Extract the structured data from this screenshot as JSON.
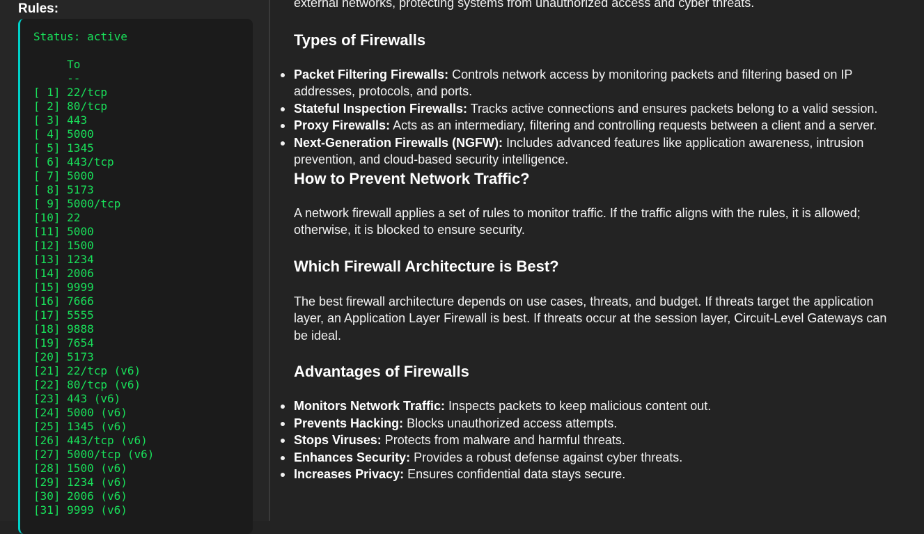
{
  "sidebar": {
    "heading": "Rules:",
    "status": "Status: active",
    "column_header": "     To",
    "column_rule": "     --",
    "rules": [
      {
        "id": "[ 1]",
        "to": "22/tcp"
      },
      {
        "id": "[ 2]",
        "to": "80/tcp"
      },
      {
        "id": "[ 3]",
        "to": "443"
      },
      {
        "id": "[ 4]",
        "to": "5000"
      },
      {
        "id": "[ 5]",
        "to": "1345"
      },
      {
        "id": "[ 6]",
        "to": "443/tcp"
      },
      {
        "id": "[ 7]",
        "to": "5000"
      },
      {
        "id": "[ 8]",
        "to": "5173"
      },
      {
        "id": "[ 9]",
        "to": "5000/tcp"
      },
      {
        "id": "[10]",
        "to": "22"
      },
      {
        "id": "[11]",
        "to": "5000"
      },
      {
        "id": "[12]",
        "to": "1500"
      },
      {
        "id": "[13]",
        "to": "1234"
      },
      {
        "id": "[14]",
        "to": "2006"
      },
      {
        "id": "[15]",
        "to": "9999"
      },
      {
        "id": "[16]",
        "to": "7666"
      },
      {
        "id": "[17]",
        "to": "5555"
      },
      {
        "id": "[18]",
        "to": "9888"
      },
      {
        "id": "[19]",
        "to": "7654"
      },
      {
        "id": "[20]",
        "to": "5173"
      },
      {
        "id": "[21]",
        "to": "22/tcp (v6)"
      },
      {
        "id": "[22]",
        "to": "80/tcp (v6)"
      },
      {
        "id": "[23]",
        "to": "443 (v6)"
      },
      {
        "id": "[24]",
        "to": "5000 (v6)"
      },
      {
        "id": "[25]",
        "to": "1345 (v6)"
      },
      {
        "id": "[26]",
        "to": "443/tcp (v6)"
      },
      {
        "id": "[27]",
        "to": "5000/tcp (v6)"
      },
      {
        "id": "[28]",
        "to": "1500 (v6)"
      },
      {
        "id": "[29]",
        "to": "1234 (v6)"
      },
      {
        "id": "[30]",
        "to": "2006 (v6)"
      },
      {
        "id": "[31]",
        "to": "9999 (v6)"
      }
    ]
  },
  "main": {
    "intro": "external networks, protecting systems from unauthorized access and cyber threats.",
    "types": {
      "heading": "Types of Firewalls",
      "items": [
        {
          "term": "Packet Filtering Firewalls:",
          "desc": " Controls network access by monitoring packets and filtering based on IP addresses, protocols, and ports."
        },
        {
          "term": "Stateful Inspection Firewalls:",
          "desc": " Tracks active connections and ensures packets belong to a valid session."
        },
        {
          "term": "Proxy Firewalls:",
          "desc": " Acts as an intermediary, filtering and controlling requests between a client and a server."
        },
        {
          "term": "Next-Generation Firewalls (NGFW):",
          "desc": " Includes advanced features like application awareness, intrusion prevention, and cloud-based security intelligence."
        }
      ]
    },
    "prevent": {
      "heading": "How to Prevent Network Traffic?",
      "text": "A network firewall applies a set of rules to monitor traffic. If the traffic aligns with the rules, it is allowed; otherwise, it is blocked to ensure security."
    },
    "architecture": {
      "heading": "Which Firewall Architecture is Best?",
      "text": "The best firewall architecture depends on use cases, threats, and budget. If threats target the application layer, an Application Layer Firewall is best. If threats occur at the session layer, Circuit-Level Gateways can be ideal."
    },
    "advantages": {
      "heading": "Advantages of Firewalls",
      "items": [
        {
          "term": "Monitors Network Traffic:",
          "desc": " Inspects packets to keep malicious content out."
        },
        {
          "term": "Prevents Hacking:",
          "desc": " Blocks unauthorized access attempts."
        },
        {
          "term": "Stops Viruses:",
          "desc": " Protects from malware and harmful threats."
        },
        {
          "term": "Enhances Security:",
          "desc": " Provides a robust defense against cyber threats."
        },
        {
          "term": "Increases Privacy:",
          "desc": " Ensures confidential data stays secure."
        }
      ]
    }
  }
}
